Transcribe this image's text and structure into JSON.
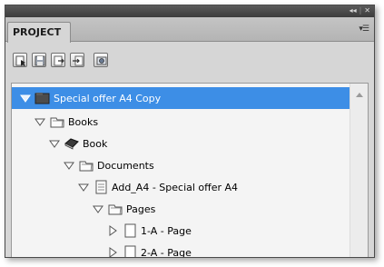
{
  "panel": {
    "tab_label": "PROJECT",
    "topbar_collapse": "◂◂",
    "topbar_close": "✕",
    "menu_glyph": "▾☰"
  },
  "toolbar": {
    "icons": [
      "select-page-icon",
      "save-icon",
      "export-icon",
      "import-icon",
      "settings-icon"
    ]
  },
  "tree": {
    "items": [
      {
        "label": "Special offer A4 Copy",
        "icon": "project-folder-icon",
        "expanded": true,
        "selected": true
      },
      {
        "label": "Books",
        "icon": "folder-icon",
        "expanded": true,
        "selected": false
      },
      {
        "label": "Book",
        "icon": "book-icon",
        "expanded": true,
        "selected": false
      },
      {
        "label": "Documents",
        "icon": "folder-icon",
        "expanded": true,
        "selected": false
      },
      {
        "label": "Add_A4 - Special offer A4",
        "icon": "document-icon",
        "expanded": true,
        "selected": false
      },
      {
        "label": "Pages",
        "icon": "folder-icon",
        "expanded": true,
        "selected": false
      },
      {
        "label": "1-A - Page",
        "icon": "page-icon",
        "expanded": false,
        "selected": false
      },
      {
        "label": "2-A - Page",
        "icon": "page-icon",
        "expanded": false,
        "selected": false
      }
    ]
  },
  "colors": {
    "selection": "#3d8ee6",
    "panel_bg": "#d6d6d6",
    "tree_bg": "#f4f4f4"
  }
}
